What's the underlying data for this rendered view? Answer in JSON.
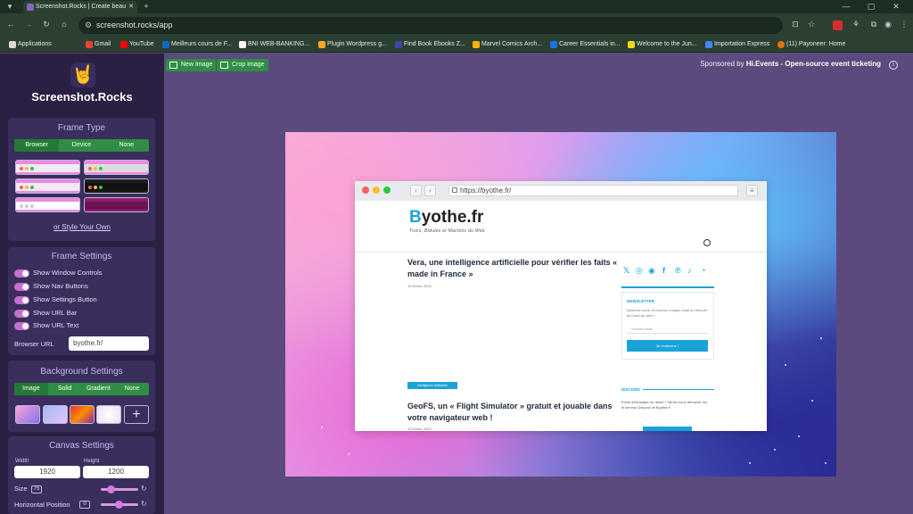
{
  "browser": {
    "tab_title": "Screenshot.Rocks | Create beau",
    "url": "screenshot.rocks/app",
    "bookmarks": [
      {
        "label": "Applications",
        "color": "#d9d9d9"
      },
      {
        "label": "Gmail",
        "color": "#ea4335"
      },
      {
        "label": "YouTube",
        "color": "#ff0000"
      },
      {
        "label": "Meilleurs cours de F...",
        "color": "#1565c0"
      },
      {
        "label": "BNI WEB-BANKING...",
        "color": "#ffffff"
      },
      {
        "label": "Plugin Wordpress g...",
        "color": "#f9a825"
      },
      {
        "label": "Find Book Ebooks Z...",
        "color": "#3949ab"
      },
      {
        "label": "Marvel Comics Arch...",
        "color": "#f4b400"
      },
      {
        "label": "Career Essentials in...",
        "color": "#1a73e8"
      },
      {
        "label": "Welcome to the Jun...",
        "color": "#f9d71c"
      },
      {
        "label": "Importation Express",
        "color": "#4285f4"
      },
      {
        "label": "(11) Payoneer: Home",
        "color": "#e8710a"
      }
    ]
  },
  "sidebar": {
    "brand": "Screenshot.Rocks",
    "frame_type": {
      "title": "Frame Type",
      "options": [
        "Browser",
        "Device",
        "None"
      ],
      "selected": "Browser",
      "style_link": "or Style Your Own"
    },
    "frame_settings": {
      "title": "Frame Settings",
      "toggles": [
        "Show Window Controls",
        "Show Nav Buttons",
        "Show Settings Button",
        "Show URL Bar",
        "Show URL Text"
      ],
      "url_label": "Browser URL",
      "url_value": "byothe.fr/"
    },
    "background_settings": {
      "title": "Background Settings",
      "options": [
        "Image",
        "Solid",
        "Gradient",
        "None"
      ],
      "selected": "Image"
    },
    "canvas_settings": {
      "title": "Canvas Settings",
      "width_label": "Width",
      "width_value": "1920",
      "height_label": "Height",
      "height_value": "1200",
      "size_label": "Size",
      "size_value": "75",
      "hpos_label": "Horizontal Position",
      "hpos_value": "0"
    }
  },
  "toolbar": {
    "new_image": "New Image",
    "crop_image": "Crop Image",
    "sponsor_prefix": "Sponsored by",
    "sponsor_name": "Hi.Events",
    "sponsor_desc": " - Open-source event ticketing"
  },
  "preview": {
    "url": "https://byothe.fr/",
    "site_name_b": "B",
    "site_name_rest": "yothe.fr",
    "tagline": "Trucs, Bidules et Machins du Web",
    "post1_title": "Vera, une intelligence artificielle pour vérifier les faits « made in France »",
    "post1_date": "13 février 2025",
    "category": "Intelligence Artificielle",
    "post2_title": "GeoFS, un « Flight Simulator » gratuit et jouable dans votre navigateur web !",
    "post2_date": "13 février 2025",
    "newsletter_title": "NEWSLETTER",
    "newsletter_text": "Abonnez-vous, et recevez chaque lundi un résumé de l'actu du web !",
    "newsletter_placeholder": "* Adresse email",
    "newsletter_button": "Je m'abonne !",
    "discord_title": "DISCORD",
    "discord_text": "Envie d'échanger en direct ? Venez nous retrouver sur le serveur Discord de Byothe.fr"
  }
}
